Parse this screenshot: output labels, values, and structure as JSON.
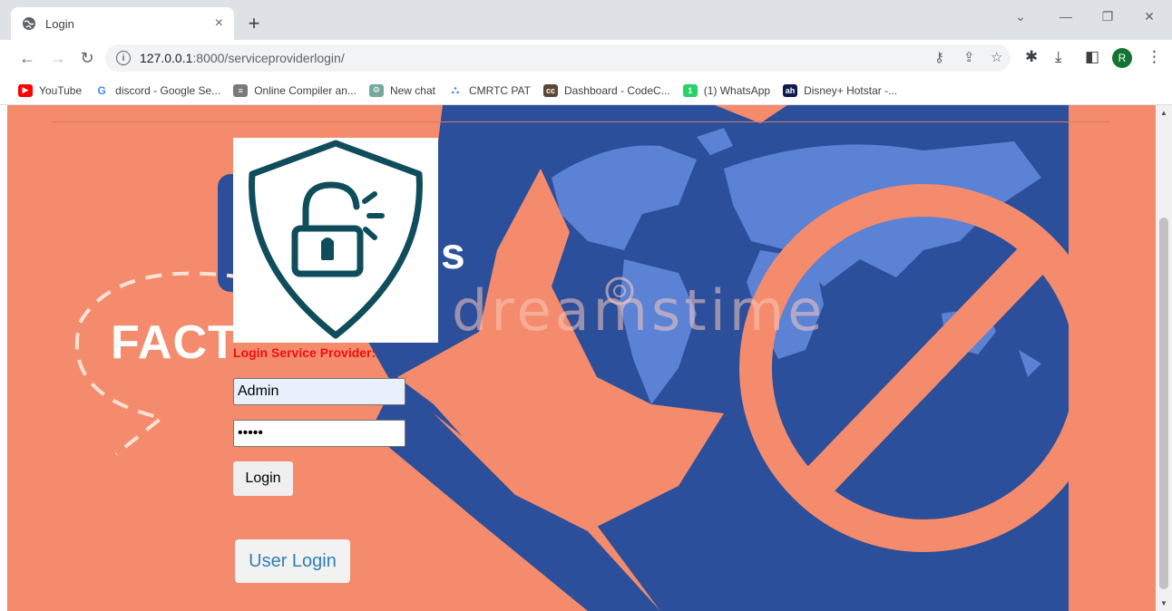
{
  "browser": {
    "tab": {
      "title": "Login",
      "close": "×"
    },
    "new_tab": "+",
    "url": {
      "host": "127.0.0.1",
      "path": ":8000/serviceproviderlogin/"
    },
    "profile_initial": "R",
    "bookmarks": [
      {
        "label": "YouTube",
        "icon": "youtube-icon",
        "color": "#ff0000",
        "glyph": "▶"
      },
      {
        "label": "discord - Google Se...",
        "icon": "google-icon",
        "color": "#ffffff",
        "glyph": "G"
      },
      {
        "label": "Online Compiler an...",
        "icon": "ide-icon",
        "color": "#7a7a7a",
        "glyph": "≡"
      },
      {
        "label": "New chat",
        "icon": "chatgpt-icon",
        "color": "#74aa9c",
        "glyph": "⚙"
      },
      {
        "label": "CMRTC PAT",
        "icon": "cmrtc-icon",
        "color": "#ffffff",
        "glyph": "⛬"
      },
      {
        "label": "Dashboard - CodeC...",
        "icon": "codechef-icon",
        "color": "#5b4638",
        "glyph": "cc"
      },
      {
        "label": "(1) WhatsApp",
        "icon": "whatsapp-icon",
        "color": "#25d366",
        "glyph": "1"
      },
      {
        "label": "Disney+ Hotstar -...",
        "icon": "hotstar-icon",
        "color": "#0c1a4e",
        "glyph": "ah"
      }
    ]
  },
  "page": {
    "background_text": "FACT",
    "watermark": "dreamstime",
    "form": {
      "label": "Login Service Provider:",
      "username_value": "Admin",
      "password_value": "•••••",
      "login_button": "Login",
      "user_login_link": "User Login"
    },
    "colors": {
      "background": "#f48b6c",
      "accent_blue": "#2b4f9a",
      "map_blue": "#5b82d4",
      "label_red": "#ee1111",
      "link_blue": "#2d7fb8",
      "shield": "#0f4c5c"
    }
  }
}
